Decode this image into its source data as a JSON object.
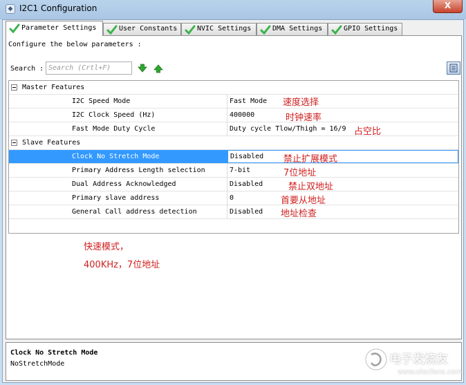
{
  "window": {
    "title": "I2C1 Configuration",
    "close_label": "X"
  },
  "tabs": [
    {
      "label": "Parameter Settings",
      "active": true
    },
    {
      "label": "User Constants",
      "active": false
    },
    {
      "label": "NVIC Settings",
      "active": false
    },
    {
      "label": "DMA Settings",
      "active": false
    },
    {
      "label": "GPIO Settings",
      "active": false
    }
  ],
  "panel": {
    "instruction": "Configure the below parameters :",
    "search_label": "Search :",
    "search_placeholder": "Search (Crtl+F)"
  },
  "groups": {
    "master": {
      "label": "Master Features",
      "params": [
        {
          "name": "I2C Speed Mode",
          "value": "Fast Mode"
        },
        {
          "name": "I2C Clock Speed (Hz)",
          "value": "400000"
        },
        {
          "name": "Fast Mode Duty Cycle",
          "value": "Duty cycle Tlow/Thigh = 16/9"
        }
      ]
    },
    "slave": {
      "label": "Slave Features",
      "params": [
        {
          "name": "Clock No Stretch Mode",
          "value": "Disabled"
        },
        {
          "name": "Primary Address Length selection",
          "value": "7-bit"
        },
        {
          "name": "Dual Address Acknowledged",
          "value": "Disabled"
        },
        {
          "name": "Primary slave address",
          "value": "0"
        },
        {
          "name": "General Call address detection",
          "value": "Disabled"
        }
      ]
    }
  },
  "annotations": {
    "speed_select": "速度选择",
    "clock_rate": "时钟速率",
    "duty": "占空比",
    "no_stretch": "禁止扩展模式",
    "seven_bit": "7位地址",
    "no_dual": "禁止双地址",
    "primary_slave": "首要从地址",
    "address_check": "地址检查",
    "summary_line1": "快速模式，",
    "summary_line2": "400KHz，7位地址"
  },
  "description": {
    "title": "Clock No Stretch Mode",
    "text": "NoStretchMode"
  },
  "watermark": {
    "name": "电子发烧友",
    "url": "www.elecfans.com"
  },
  "colors": {
    "selection": "#3399ff",
    "annotation": "#d02020",
    "tab_check": "#3bb34a",
    "arrow": "#2ea82e"
  }
}
